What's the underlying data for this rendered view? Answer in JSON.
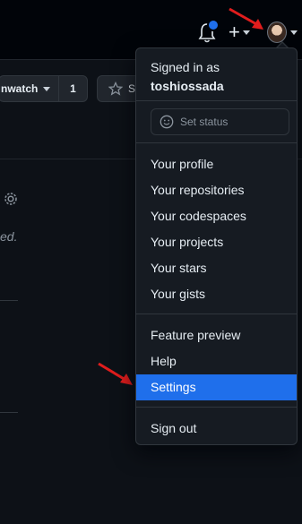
{
  "repo_bar": {
    "watch_label": "nwatch",
    "watch_count": "1",
    "star_label": "S"
  },
  "content": {
    "fragment_text": "ed."
  },
  "user_menu": {
    "signed_in_label": "Signed in as",
    "username": "toshiossada",
    "set_status_placeholder": "Set status",
    "items": [
      {
        "label": "Your profile"
      },
      {
        "label": "Your repositories"
      },
      {
        "label": "Your codespaces"
      },
      {
        "label": "Your projects"
      },
      {
        "label": "Your stars"
      },
      {
        "label": "Your gists"
      },
      {
        "label": "Feature preview"
      },
      {
        "label": "Help"
      },
      {
        "label": "Settings",
        "active": true
      },
      {
        "label": "Sign out"
      }
    ]
  },
  "icons": {
    "notifications": "bell-icon",
    "create": "plus-icon",
    "avatar": "avatar",
    "status": "smiley-icon",
    "settings": "gear-icon",
    "star": "star-icon"
  },
  "colors": {
    "accent": "#1f6feb",
    "annotation_arrow": "#e11d1d",
    "background": "#0d1117",
    "menu_background": "#161b22"
  }
}
